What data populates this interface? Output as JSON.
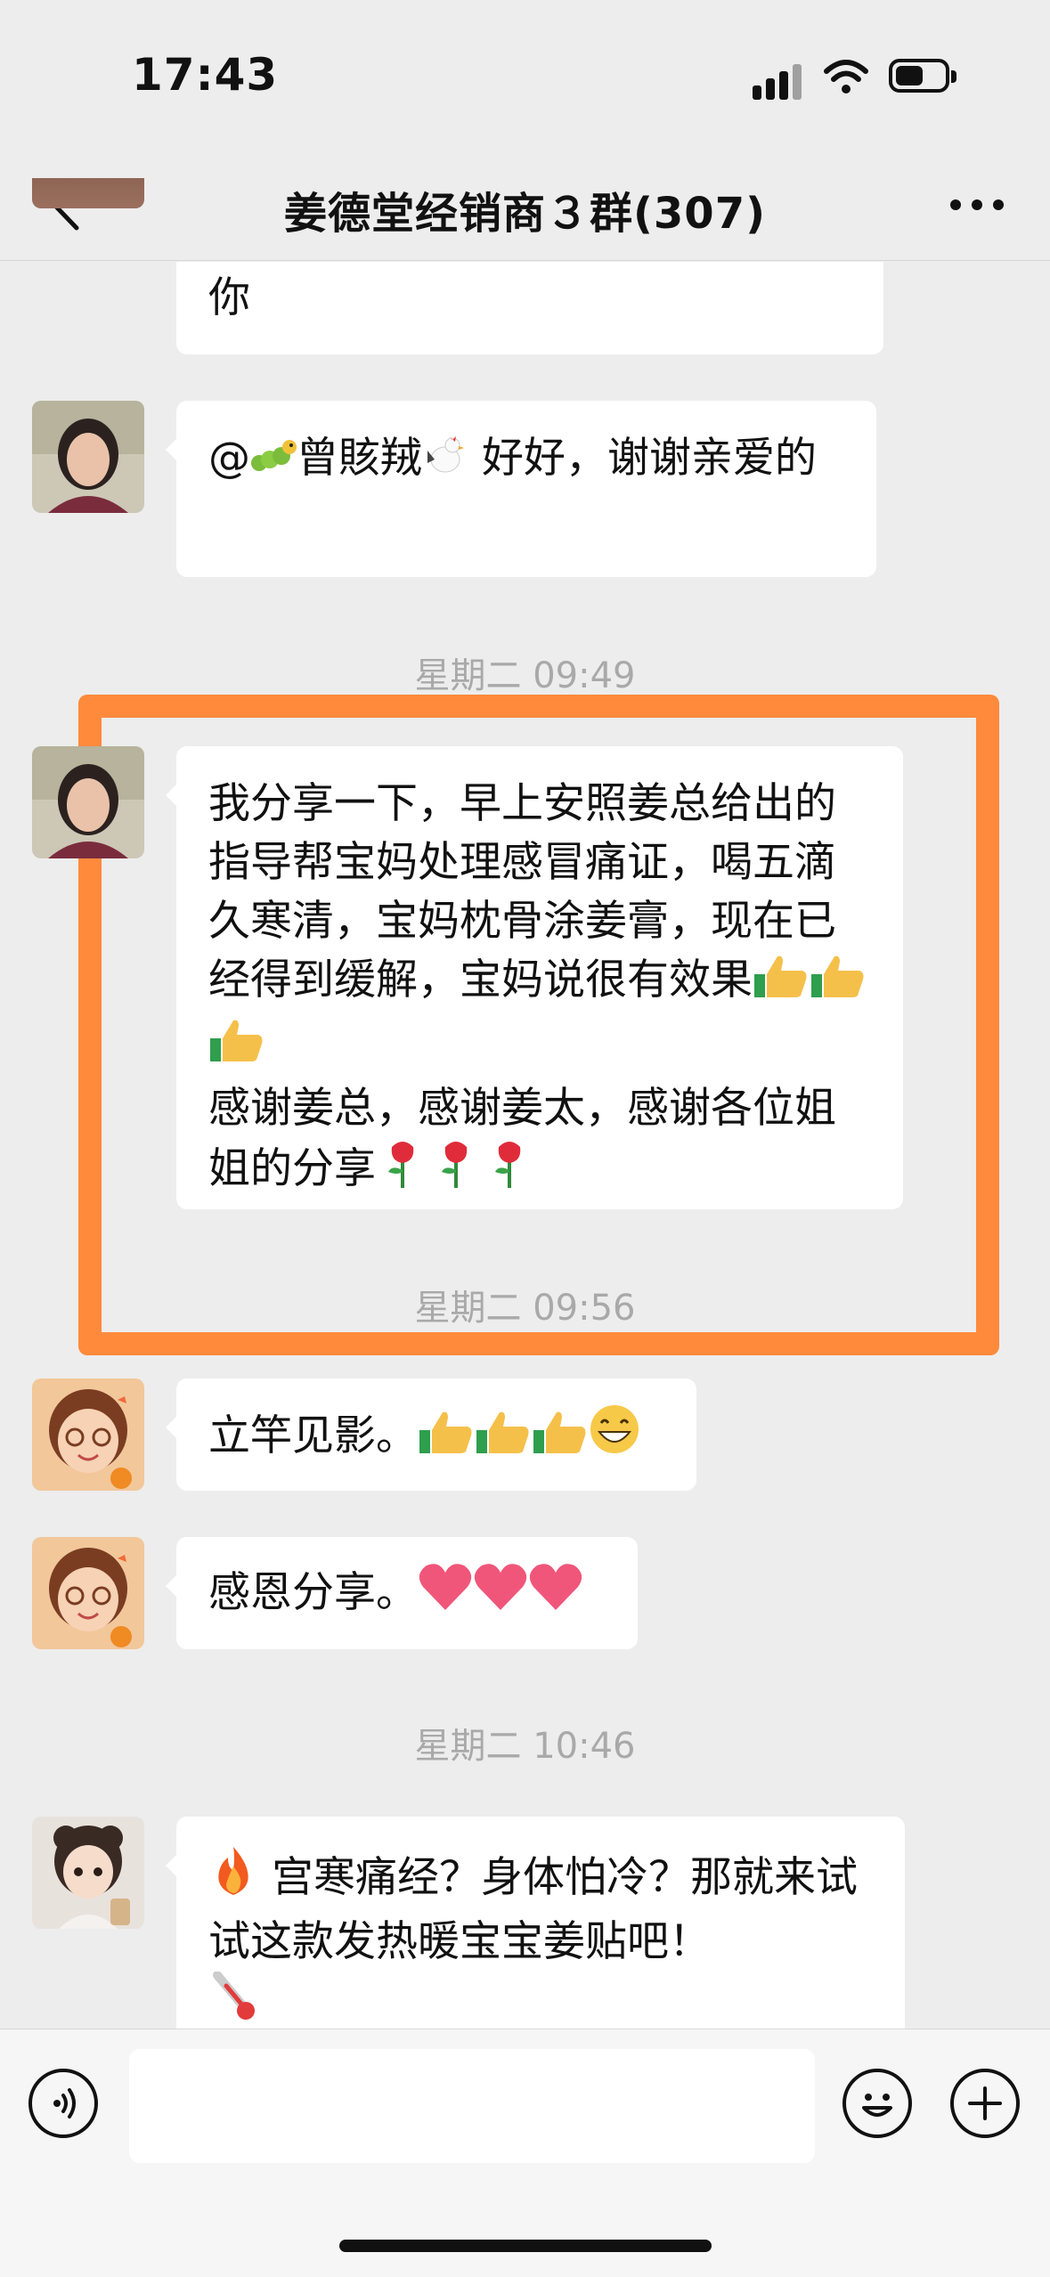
{
  "status_bar": {
    "time": "17:43"
  },
  "header": {
    "title": "姜德堂经销商３群(307)"
  },
  "messages": [
    {
      "text": "你"
    },
    {
      "prefix": "@",
      "name": "曾賅羢",
      "suffix": " 好好，谢谢亲爱的"
    },
    {
      "timestamp": "星期二 09:49"
    },
    {
      "text": "我分享一下，早上安照姜总给出的指导帮宝妈处理感冒痛证，喝五滴久寒清，宝妈枕骨涂姜膏，现在已经得到缓解，宝妈说很有效果",
      "line2": "感谢姜总，感谢姜太，感谢各位姐姐的分享"
    },
    {
      "timestamp": "星期二 09:56"
    },
    {
      "text": "立竿见影。"
    },
    {
      "text": "感恩分享。"
    },
    {
      "timestamp": "星期二 10:46"
    },
    {
      "text": "宫寒痛经？身体怕冷？那就来试试这款发热暖宝宝姜贴吧！"
    }
  ],
  "icons": [
    "back-icon",
    "more-icon",
    "voice-icon",
    "emoji-icon",
    "plus-icon",
    "thumbs-up-emoji",
    "rose-emoji",
    "heart-emoji",
    "fire-emoji",
    "thermometer-emoji",
    "caterpillar-emoji",
    "rooster-emoji",
    "grin-emoji"
  ],
  "colors": {
    "background": "#ededed",
    "bubble": "#ffffff",
    "highlight": "#ff8a3c",
    "timestamp": "#a9a9a9"
  }
}
